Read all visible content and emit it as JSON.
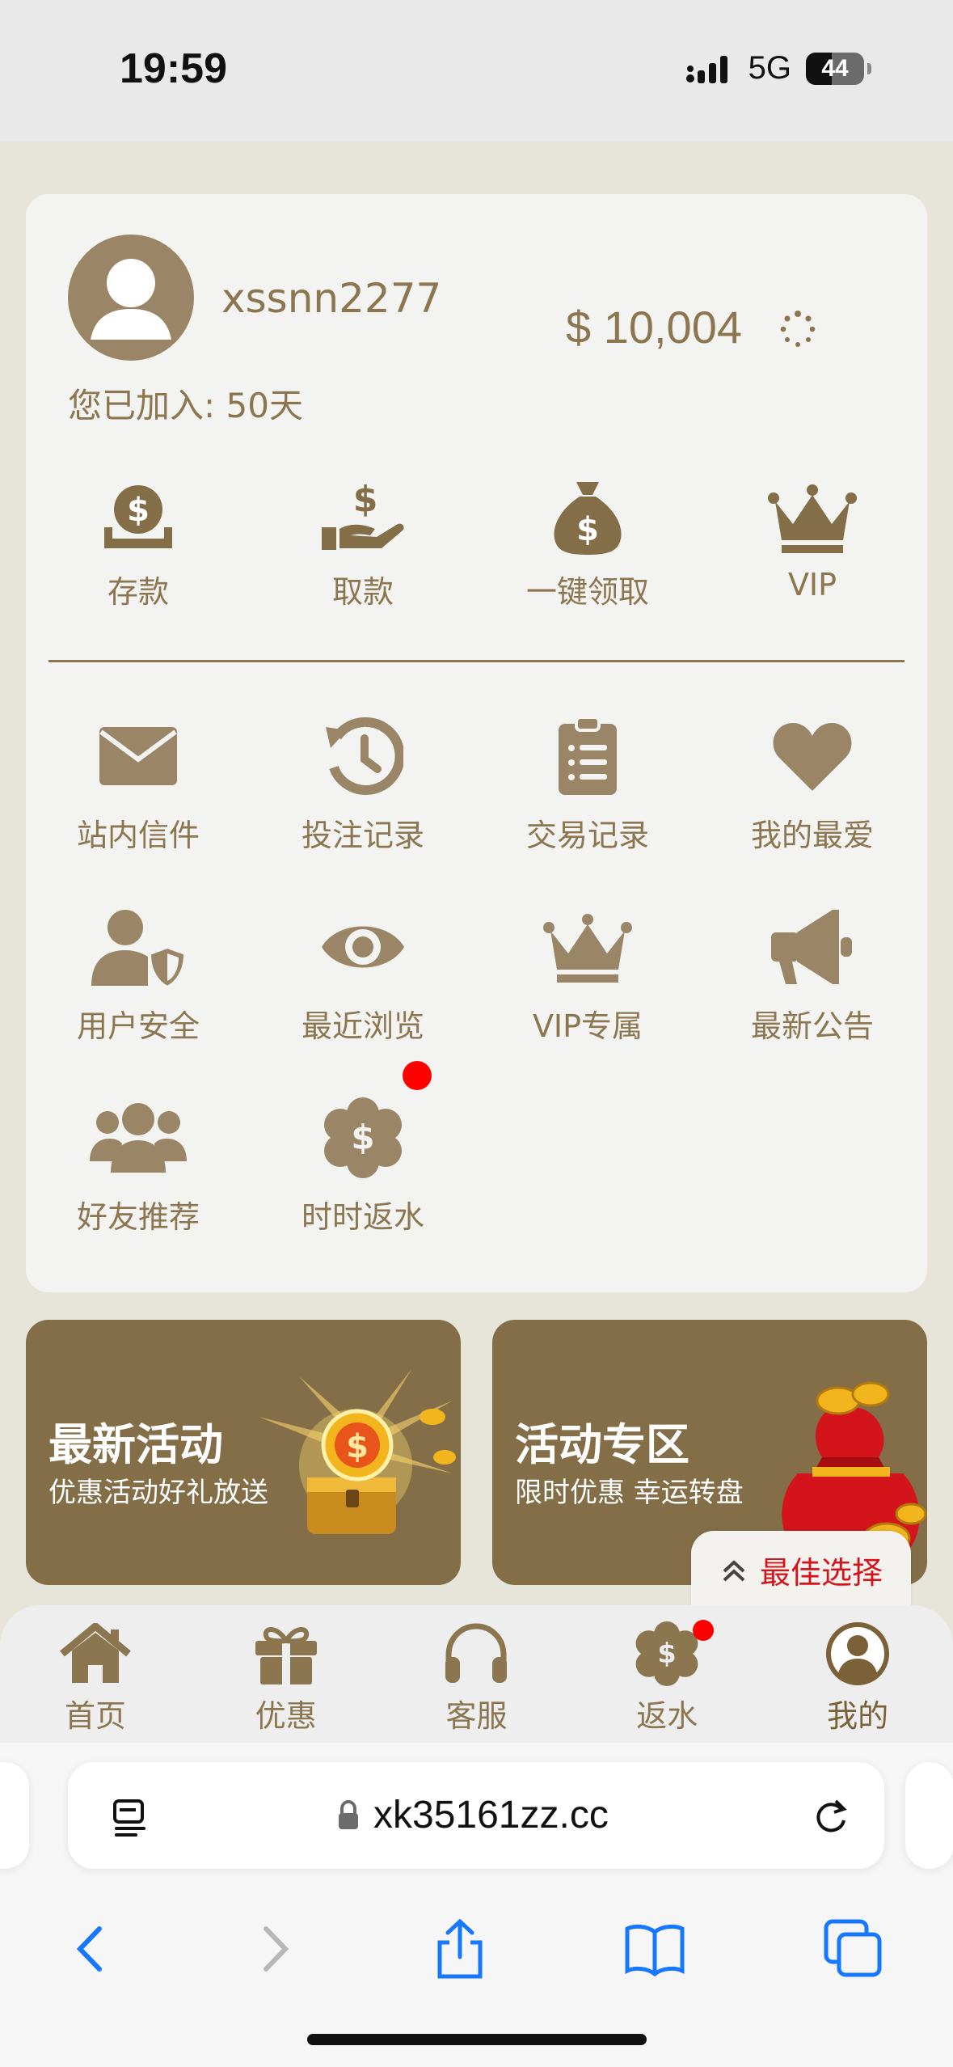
{
  "status_bar": {
    "time": "19:59",
    "network": "5G",
    "battery": "44",
    "battery_level": 0.44
  },
  "profile": {
    "username": "xssnn2277",
    "joined_label": "您已加入: 50天",
    "balance": "$ 10,004"
  },
  "quick_actions": [
    {
      "label": "存款",
      "icon": "deposit-icon"
    },
    {
      "label": "取款",
      "icon": "withdraw-icon"
    },
    {
      "label": "一键领取",
      "icon": "money-bag-icon"
    },
    {
      "label": "VIP",
      "icon": "crown-icon"
    }
  ],
  "menu": [
    {
      "label": "站内信件",
      "icon": "envelope-icon"
    },
    {
      "label": "投注记录",
      "icon": "history-icon"
    },
    {
      "label": "交易记录",
      "icon": "clipboard-list-icon"
    },
    {
      "label": "我的最爱",
      "icon": "heart-icon"
    },
    {
      "label": "用户安全",
      "icon": "user-shield-icon"
    },
    {
      "label": "最近浏览",
      "icon": "eye-icon"
    },
    {
      "label": "VIP专属",
      "icon": "crown-icon"
    },
    {
      "label": "最新公告",
      "icon": "megaphone-icon"
    },
    {
      "label": "好友推荐",
      "icon": "users-icon"
    },
    {
      "label": "时时返水",
      "icon": "rebate-badge-icon",
      "has_dot": true
    }
  ],
  "banners": [
    {
      "title": "最新活动",
      "subtitle": "优惠活动好礼放送"
    },
    {
      "title": "活动专区",
      "subtitle": "限时优惠 幸运转盘"
    }
  ],
  "best_choice": {
    "label": "最佳选择"
  },
  "bottom_nav": [
    {
      "label": "首页",
      "icon": "home-icon"
    },
    {
      "label": "优惠",
      "icon": "gift-icon"
    },
    {
      "label": "客服",
      "icon": "headset-icon"
    },
    {
      "label": "返水",
      "icon": "rebate-badge-icon",
      "has_dot": true
    },
    {
      "label": "我的",
      "icon": "user-circle-icon",
      "active": true
    }
  ],
  "browser": {
    "url": "xk35161zz.cc"
  },
  "colors": {
    "accent": "#8b7650",
    "banner": "#836e48",
    "dot": "#ff0000",
    "best": "#d4141b"
  }
}
